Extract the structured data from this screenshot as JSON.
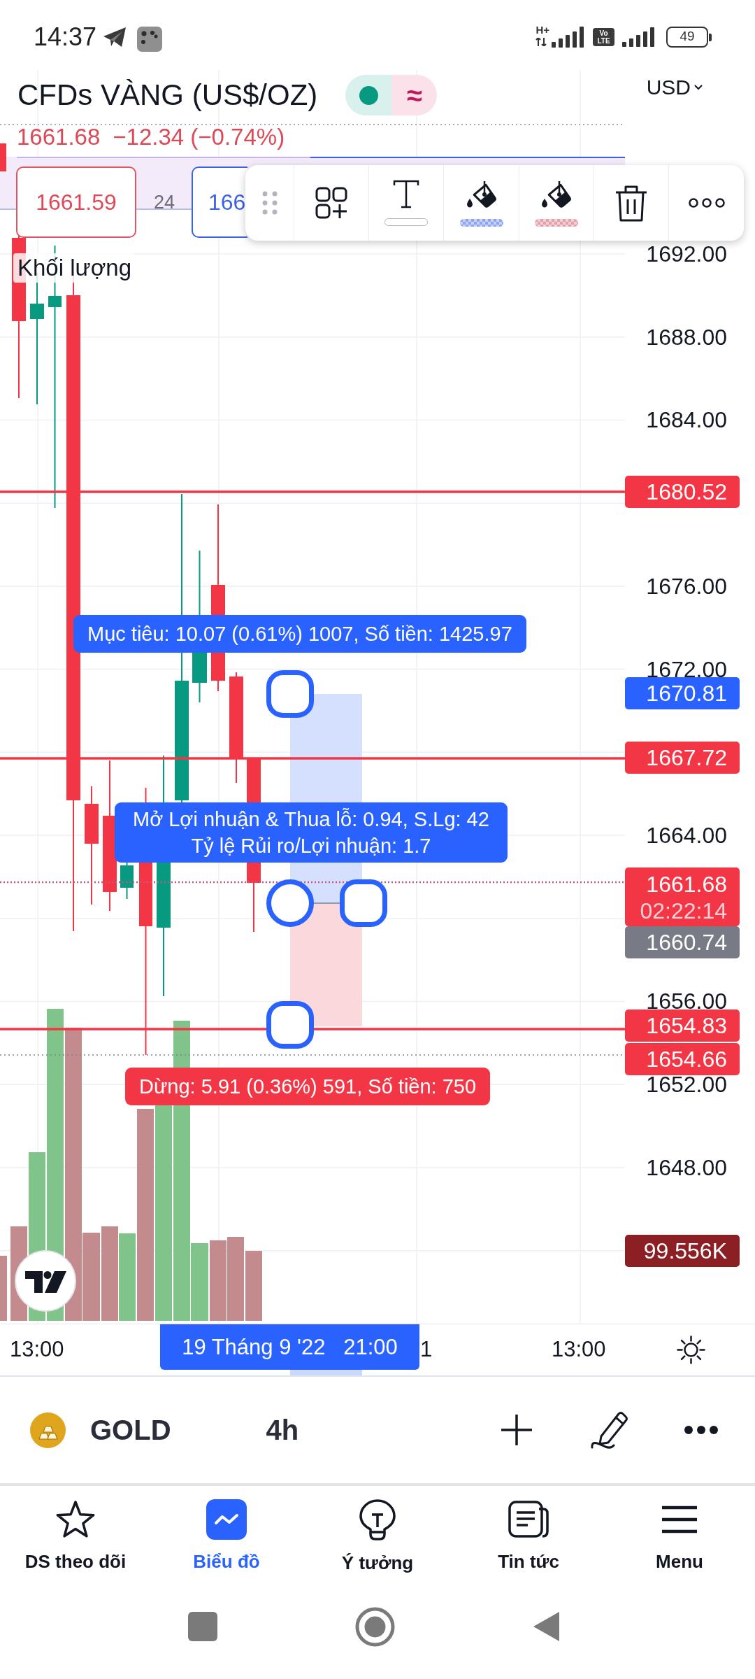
{
  "status_bar": {
    "time": "14:37",
    "network_type": "H+",
    "volte": [
      "Vo",
      "LTE"
    ],
    "battery": "49"
  },
  "header": {
    "title": "CFDs VÀNG (US$/OZ)",
    "status_sign": "≈",
    "currency": "USD"
  },
  "quote": {
    "price": "1661.68",
    "change": "−12.34 (−0.74%)"
  },
  "trade_buttons": {
    "sell": "1661.59",
    "spread": "24",
    "buy": "166"
  },
  "drawing_toolbar": [
    {
      "kind": "drag"
    },
    {
      "kind": "templates"
    },
    {
      "kind": "text",
      "color": "#ffffff"
    },
    {
      "kind": "fill",
      "color": "#8fa4ec"
    },
    {
      "kind": "fill",
      "color": "#e6a0aa"
    },
    {
      "kind": "delete"
    },
    {
      "kind": "more"
    }
  ],
  "volume_legend": "Khối lượng",
  "price_axis": [
    "1692.00",
    "1688.00",
    "1684.00",
    "1676.00",
    "1672.00",
    "1664.00",
    "1656.00",
    "1652.00",
    "1648.00"
  ],
  "price_tags": [
    {
      "text": "1680.52",
      "color": "#f23645"
    },
    {
      "text": "1670.81",
      "color": "#2962ff"
    },
    {
      "text": "1667.72",
      "color": "#f23645"
    },
    {
      "text": "1661.68",
      "countdown": "02:22:14",
      "color": "#f23645"
    },
    {
      "text": "1660.74",
      "color": "#787b86"
    },
    {
      "text": "1654.83",
      "color": "#f23645"
    },
    {
      "text": "1654.66",
      "color": "#f23645"
    },
    {
      "text": "99.556K",
      "color": "#8c1f24"
    }
  ],
  "position_tool": {
    "target_label": "Mục tiêu: 10.07 (0.61%) 1007, Số tiền: 1425.97",
    "info_lines": [
      "Mở Lợi nhuận & Thua lỗ: 0.94, S.Lg: 42",
      "Tỷ lệ Rủi ro/Lợi nhuận: 1.7"
    ],
    "stop_label": "Dừng: 5.91 (0.36%) 591, Số tiền: 750"
  },
  "time_axis": {
    "labels": [
      "13:00",
      "1",
      "13:00"
    ],
    "crosshair_label": "19 Tháng 9 '22   21:00"
  },
  "symbol_bar": {
    "symbol": "GOLD",
    "interval": "4h"
  },
  "bottom_nav": [
    {
      "kind": "watchlist",
      "label": "DS theo dõi",
      "selected": false
    },
    {
      "kind": "chart",
      "label": "Biểu đồ",
      "selected": true
    },
    {
      "kind": "ideas",
      "label": "Ý tưởng",
      "selected": false
    },
    {
      "kind": "news",
      "label": "Tin tức",
      "selected": false
    },
    {
      "kind": "menu",
      "label": "Menu",
      "selected": false
    }
  ]
}
